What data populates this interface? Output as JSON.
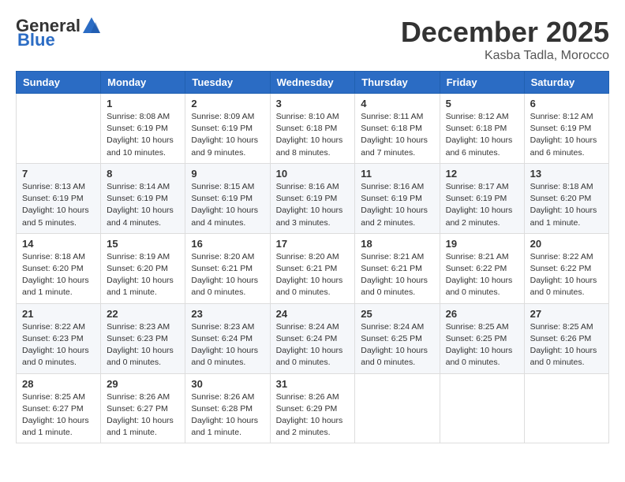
{
  "header": {
    "logo_general": "General",
    "logo_blue": "Blue",
    "month": "December 2025",
    "location": "Kasba Tadla, Morocco"
  },
  "days_of_week": [
    "Sunday",
    "Monday",
    "Tuesday",
    "Wednesday",
    "Thursday",
    "Friday",
    "Saturday"
  ],
  "weeks": [
    [
      {
        "day": "",
        "info": ""
      },
      {
        "day": "1",
        "info": "Sunrise: 8:08 AM\nSunset: 6:19 PM\nDaylight: 10 hours\nand 10 minutes."
      },
      {
        "day": "2",
        "info": "Sunrise: 8:09 AM\nSunset: 6:19 PM\nDaylight: 10 hours\nand 9 minutes."
      },
      {
        "day": "3",
        "info": "Sunrise: 8:10 AM\nSunset: 6:18 PM\nDaylight: 10 hours\nand 8 minutes."
      },
      {
        "day": "4",
        "info": "Sunrise: 8:11 AM\nSunset: 6:18 PM\nDaylight: 10 hours\nand 7 minutes."
      },
      {
        "day": "5",
        "info": "Sunrise: 8:12 AM\nSunset: 6:18 PM\nDaylight: 10 hours\nand 6 minutes."
      },
      {
        "day": "6",
        "info": "Sunrise: 8:12 AM\nSunset: 6:19 PM\nDaylight: 10 hours\nand 6 minutes."
      }
    ],
    [
      {
        "day": "7",
        "info": "Sunrise: 8:13 AM\nSunset: 6:19 PM\nDaylight: 10 hours\nand 5 minutes."
      },
      {
        "day": "8",
        "info": "Sunrise: 8:14 AM\nSunset: 6:19 PM\nDaylight: 10 hours\nand 4 minutes."
      },
      {
        "day": "9",
        "info": "Sunrise: 8:15 AM\nSunset: 6:19 PM\nDaylight: 10 hours\nand 4 minutes."
      },
      {
        "day": "10",
        "info": "Sunrise: 8:16 AM\nSunset: 6:19 PM\nDaylight: 10 hours\nand 3 minutes."
      },
      {
        "day": "11",
        "info": "Sunrise: 8:16 AM\nSunset: 6:19 PM\nDaylight: 10 hours\nand 2 minutes."
      },
      {
        "day": "12",
        "info": "Sunrise: 8:17 AM\nSunset: 6:19 PM\nDaylight: 10 hours\nand 2 minutes."
      },
      {
        "day": "13",
        "info": "Sunrise: 8:18 AM\nSunset: 6:20 PM\nDaylight: 10 hours\nand 1 minute."
      }
    ],
    [
      {
        "day": "14",
        "info": "Sunrise: 8:18 AM\nSunset: 6:20 PM\nDaylight: 10 hours\nand 1 minute."
      },
      {
        "day": "15",
        "info": "Sunrise: 8:19 AM\nSunset: 6:20 PM\nDaylight: 10 hours\nand 1 minute."
      },
      {
        "day": "16",
        "info": "Sunrise: 8:20 AM\nSunset: 6:21 PM\nDaylight: 10 hours\nand 0 minutes."
      },
      {
        "day": "17",
        "info": "Sunrise: 8:20 AM\nSunset: 6:21 PM\nDaylight: 10 hours\nand 0 minutes."
      },
      {
        "day": "18",
        "info": "Sunrise: 8:21 AM\nSunset: 6:21 PM\nDaylight: 10 hours\nand 0 minutes."
      },
      {
        "day": "19",
        "info": "Sunrise: 8:21 AM\nSunset: 6:22 PM\nDaylight: 10 hours\nand 0 minutes."
      },
      {
        "day": "20",
        "info": "Sunrise: 8:22 AM\nSunset: 6:22 PM\nDaylight: 10 hours\nand 0 minutes."
      }
    ],
    [
      {
        "day": "21",
        "info": "Sunrise: 8:22 AM\nSunset: 6:23 PM\nDaylight: 10 hours\nand 0 minutes."
      },
      {
        "day": "22",
        "info": "Sunrise: 8:23 AM\nSunset: 6:23 PM\nDaylight: 10 hours\nand 0 minutes."
      },
      {
        "day": "23",
        "info": "Sunrise: 8:23 AM\nSunset: 6:24 PM\nDaylight: 10 hours\nand 0 minutes."
      },
      {
        "day": "24",
        "info": "Sunrise: 8:24 AM\nSunset: 6:24 PM\nDaylight: 10 hours\nand 0 minutes."
      },
      {
        "day": "25",
        "info": "Sunrise: 8:24 AM\nSunset: 6:25 PM\nDaylight: 10 hours\nand 0 minutes."
      },
      {
        "day": "26",
        "info": "Sunrise: 8:25 AM\nSunset: 6:25 PM\nDaylight: 10 hours\nand 0 minutes."
      },
      {
        "day": "27",
        "info": "Sunrise: 8:25 AM\nSunset: 6:26 PM\nDaylight: 10 hours\nand 0 minutes."
      }
    ],
    [
      {
        "day": "28",
        "info": "Sunrise: 8:25 AM\nSunset: 6:27 PM\nDaylight: 10 hours\nand 1 minute."
      },
      {
        "day": "29",
        "info": "Sunrise: 8:26 AM\nSunset: 6:27 PM\nDaylight: 10 hours\nand 1 minute."
      },
      {
        "day": "30",
        "info": "Sunrise: 8:26 AM\nSunset: 6:28 PM\nDaylight: 10 hours\nand 1 minute."
      },
      {
        "day": "31",
        "info": "Sunrise: 8:26 AM\nSunset: 6:29 PM\nDaylight: 10 hours\nand 2 minutes."
      },
      {
        "day": "",
        "info": ""
      },
      {
        "day": "",
        "info": ""
      },
      {
        "day": "",
        "info": ""
      }
    ]
  ]
}
